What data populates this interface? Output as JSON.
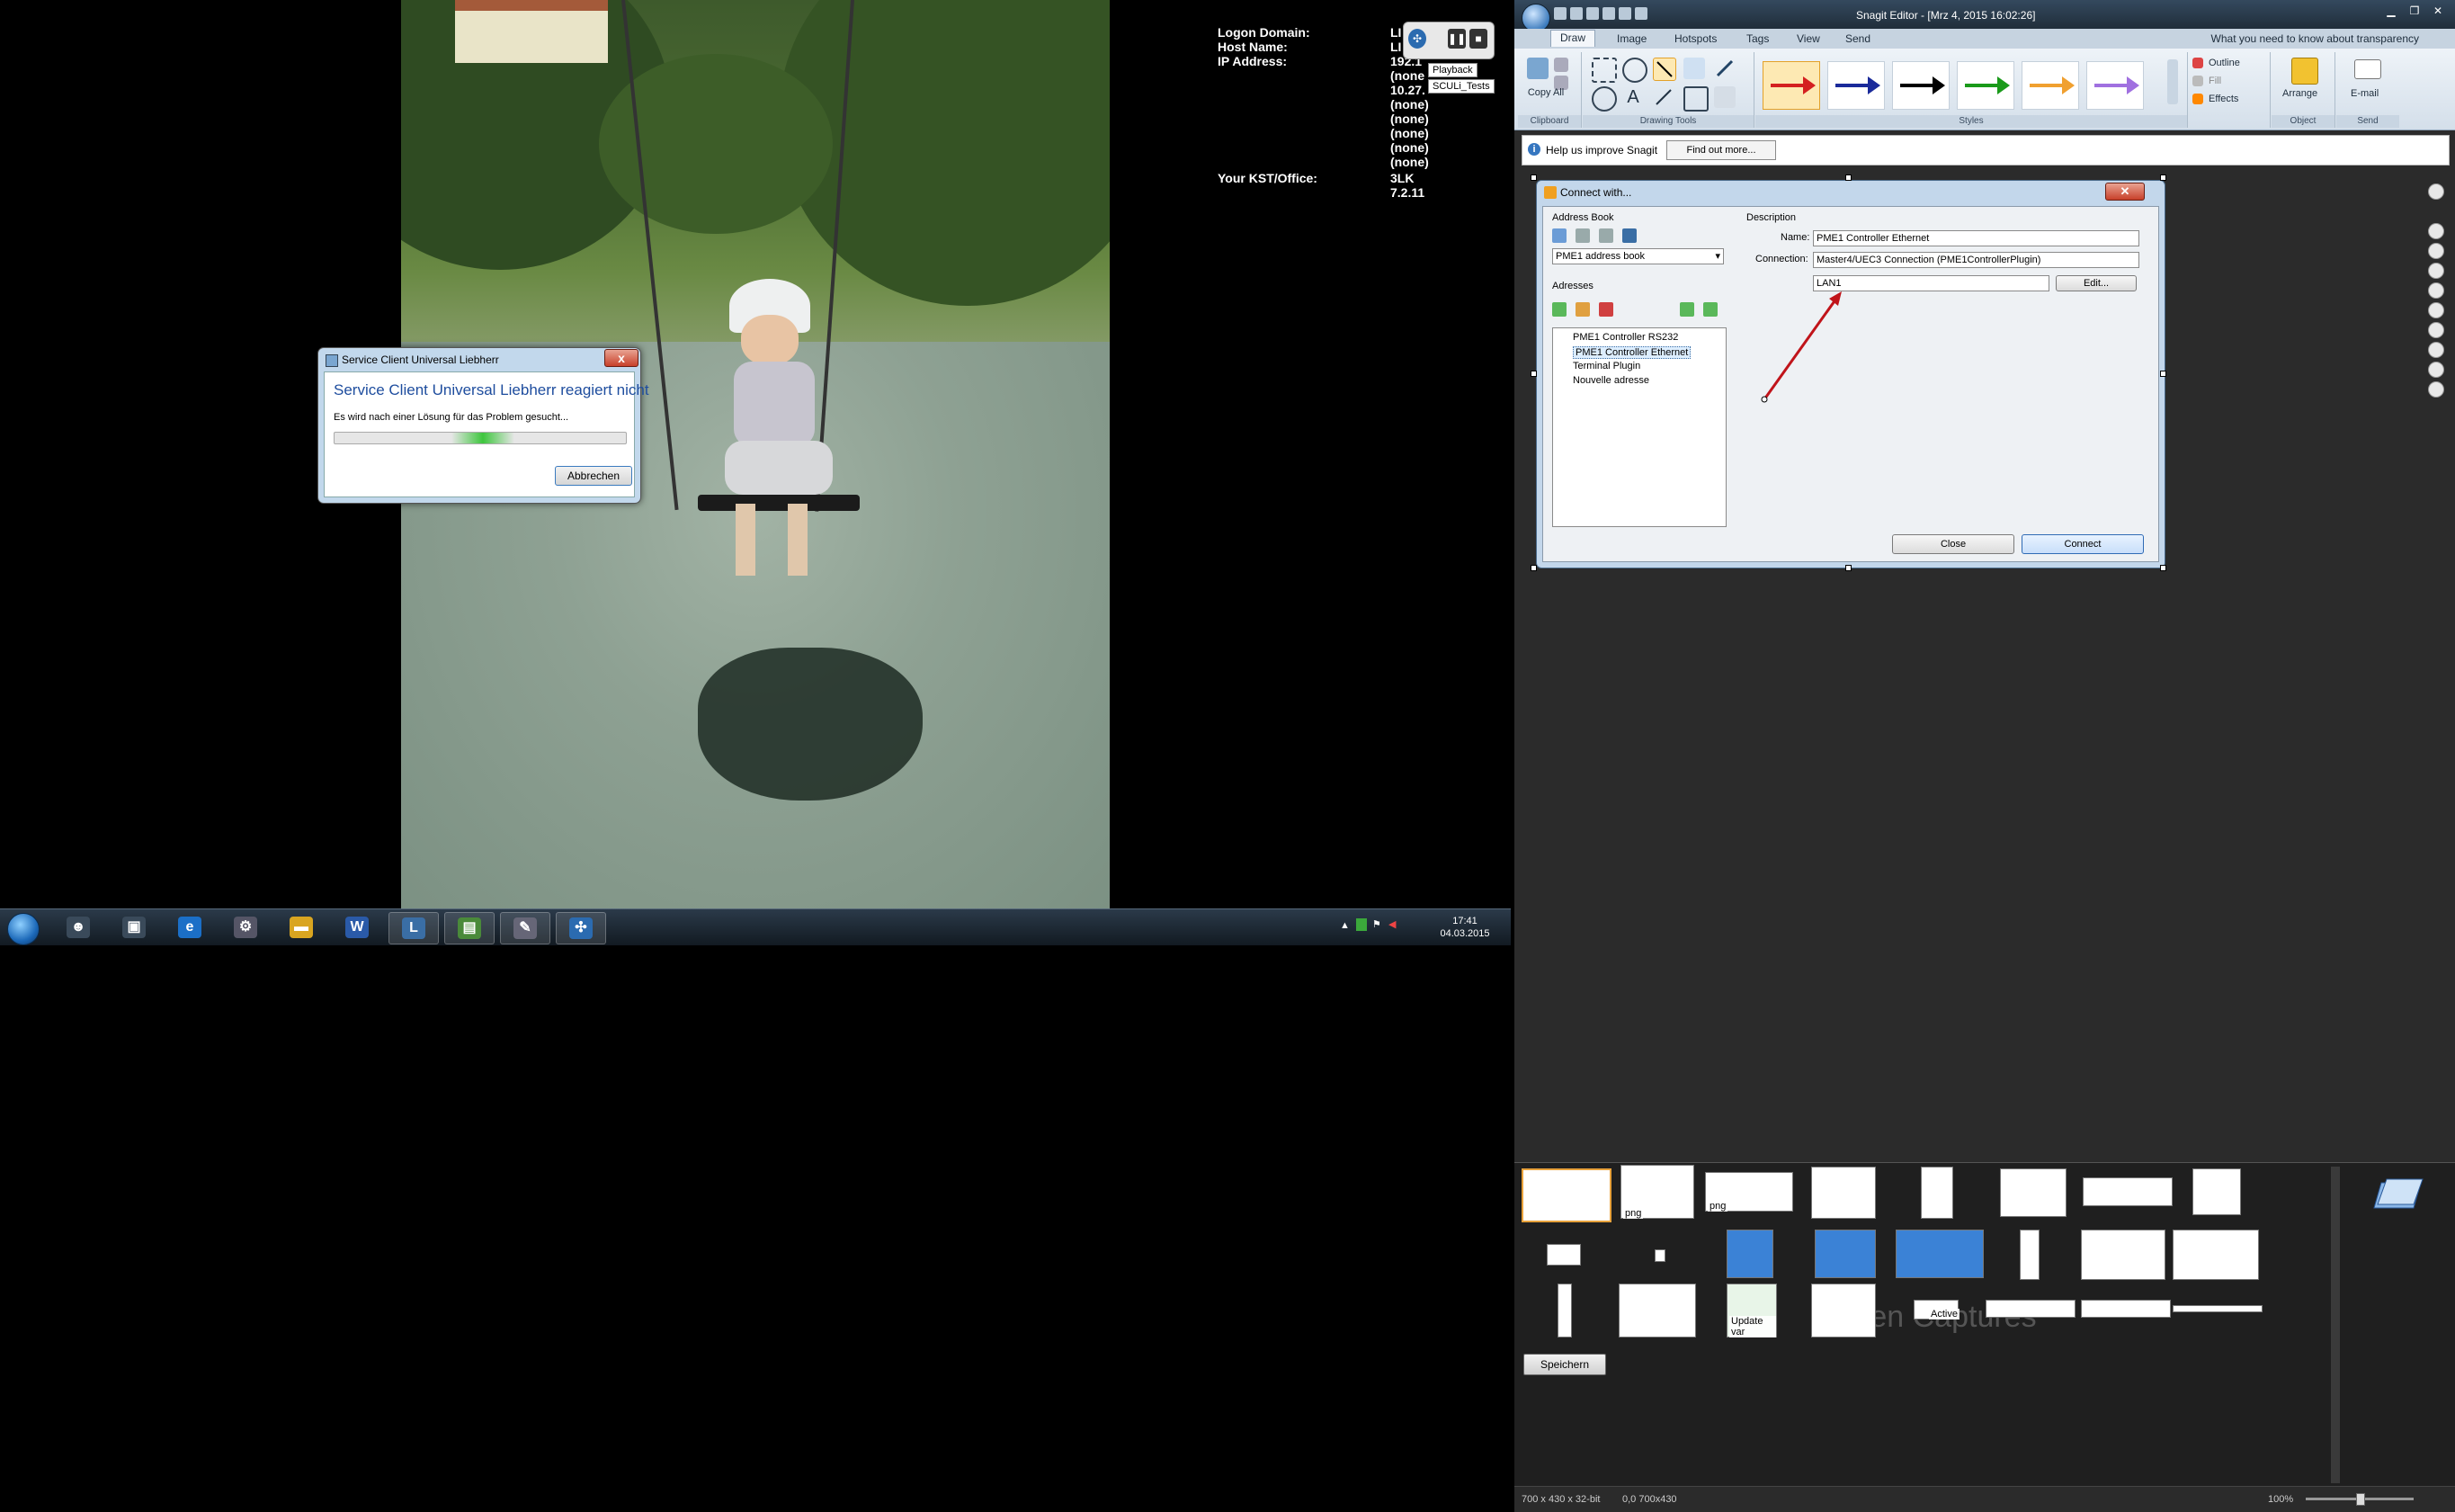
{
  "left_desktop": {
    "network_info": {
      "logon_domain_label": "Logon Domain:",
      "host_name_label": "Host Name:",
      "ip_address_label": "IP Address:",
      "kst_label": "Your KST/Office:",
      "logon_domain_value": "LI",
      "host_name_value": "LI",
      "ip_address_value": "192.1",
      "ip_line2": "(none",
      "ip_line3": "10.27.",
      "ip_line4": "(none)",
      "ip_line5": "(none)",
      "ip_line6": "(none)",
      "ip_line7": "(none)",
      "ip_line8": "(none)",
      "kst_value1": "3LK",
      "kst_value2": "7.2.11"
    },
    "widget": {
      "tip_playback": "Playback",
      "tip_tests": "SCULi_Tests"
    },
    "error_dialog": {
      "title": "Service Client Universal Liebherr",
      "heading": "Service Client Universal Liebherr reagiert nicht",
      "message": "Es wird nach einer Lösung für das Problem gesucht...",
      "abort_button": "Abbrechen",
      "close_symbol": "x"
    },
    "taskbar": {
      "clock_time": "17:41",
      "clock_date": "04.03.2015",
      "apps": [
        {
          "icon": "user-manager-icon",
          "glyph": "☻"
        },
        {
          "icon": "network-app-icon",
          "glyph": "▣"
        },
        {
          "icon": "internet-explorer-icon",
          "glyph": "e"
        },
        {
          "icon": "settings-icon",
          "glyph": "⚙"
        },
        {
          "icon": "folder-icon",
          "glyph": "▬"
        },
        {
          "icon": "word-icon",
          "glyph": "W"
        },
        {
          "icon": "service-client-icon",
          "glyph": "L"
        },
        {
          "icon": "chart-app-icon",
          "glyph": "▤"
        },
        {
          "icon": "tool-app-icon",
          "glyph": "✎"
        },
        {
          "icon": "liebherr-app-icon",
          "glyph": "✣"
        }
      ]
    }
  },
  "snagit": {
    "window_title": "Snagit Editor - [Mrz 4, 2015 16:02:26]",
    "tabs": [
      "Draw",
      "Image",
      "Hotspots",
      "Tags",
      "View",
      "Send"
    ],
    "active_tab": "Draw",
    "help_text": "What you need to know about transparency",
    "ribbon": {
      "copy_all": "Copy All",
      "clipboard_group": "Clipboard",
      "drawing_tools_group": "Drawing Tools",
      "styles_group": "Styles",
      "outline": "Outline",
      "fill": "Fill",
      "effects": "Effects",
      "arrange": "Arrange",
      "object_group": "Object",
      "email": "E-mail",
      "send_group": "Send"
    },
    "style_colors": [
      "#d42020",
      "#1a2a9a",
      "#000000",
      "#1a9a1a",
      "#f0a030",
      "#a070e0"
    ],
    "infobar": {
      "text": "Help us improve Snagit",
      "button": "Find out more..."
    },
    "connect_dialog": {
      "title": "Connect with...",
      "address_book_label": "Address Book",
      "address_book_select": "PME1 address book",
      "adresses_label": "Adresses",
      "addresses": [
        "PME1 Controller RS232",
        "PME1 Controller Ethernet",
        "Terminal Plugin",
        "Nouvelle adresse"
      ],
      "selected_index": 1,
      "description_label": "Description",
      "name_label": "Name:",
      "name_value": "PME1 Controller Ethernet",
      "connection_label": "Connection:",
      "connection_value": "Master4/UEC3 Connection (PME1ControllerPlugin)",
      "lan_value": "LAN1",
      "edit_button": "Edit...",
      "close_button": "Close",
      "connect_button": "Connect"
    },
    "tray": {
      "watermark": "Open Captures",
      "save_button": "Speichern",
      "thumb_tags": [
        "png",
        "png"
      ],
      "thumb_active": "Active",
      "thumb_update": "Update var"
    },
    "status": {
      "dimensions": "700 x 430 x 32-bit",
      "coords": "0,0  700x430",
      "zoom": "100%"
    }
  }
}
